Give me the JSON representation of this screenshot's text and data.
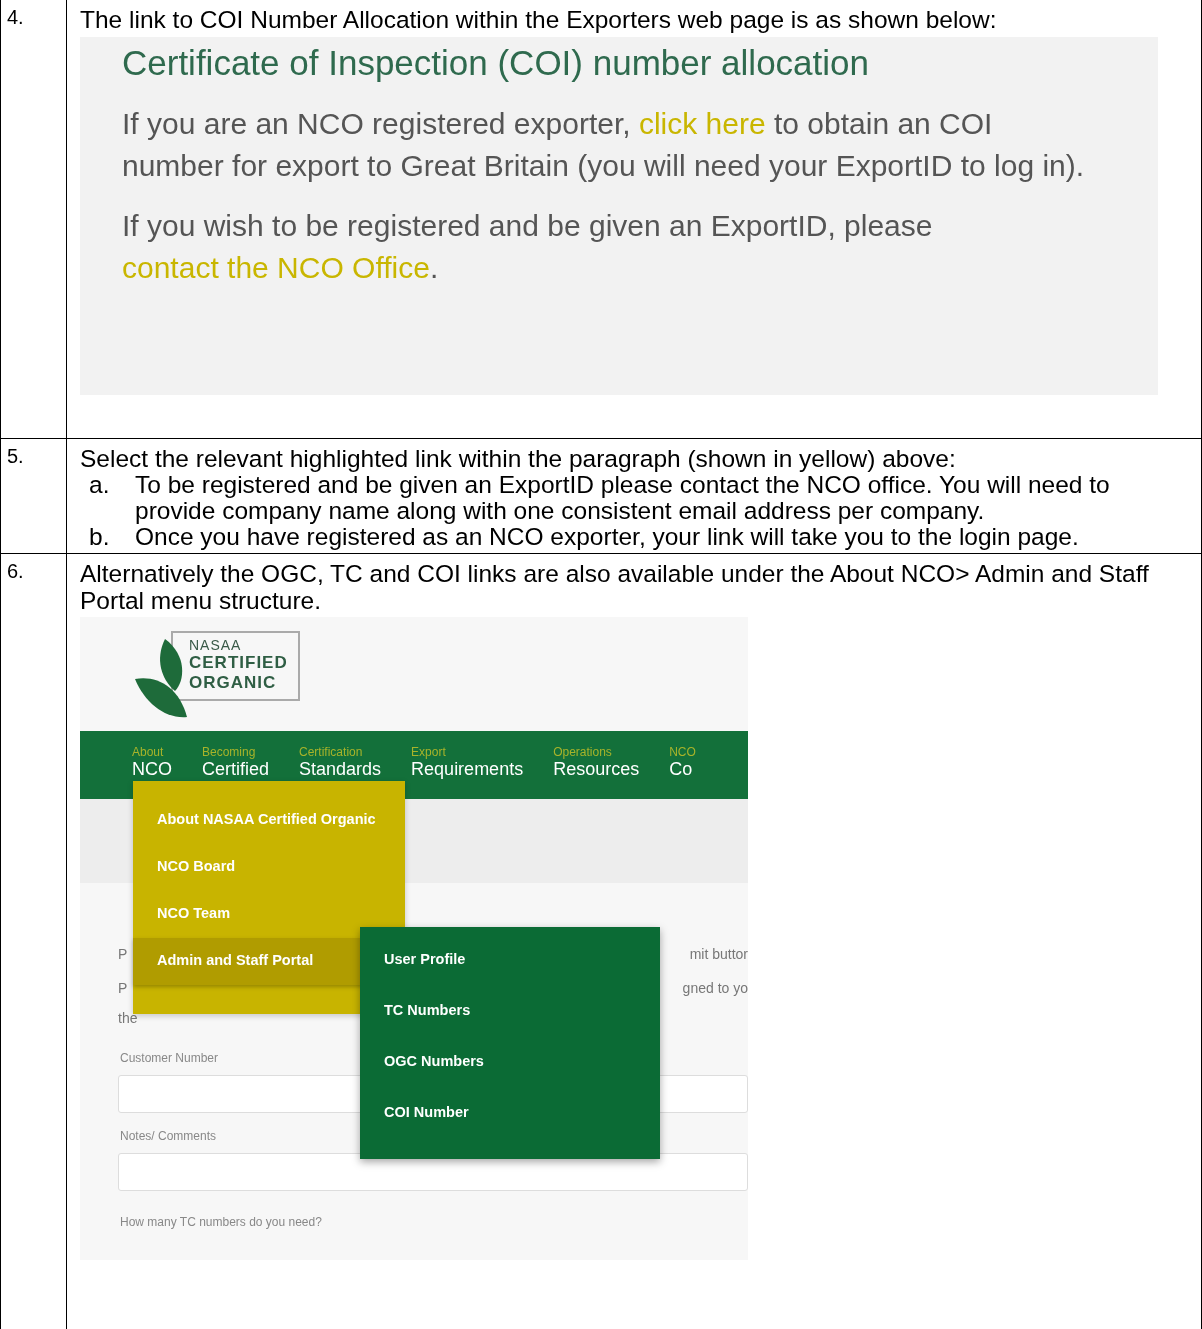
{
  "steps": [
    {
      "number": "4.",
      "kind": "panel",
      "text": "The link to COI Number Allocation within the Exporters web page is as shown below:",
      "panel": {
        "title": "Certificate of Inspection (COI) number allocation",
        "paragraphs": [
          [
            {
              "text": "If you are an NCO registered exporter, ",
              "kind": "text"
            },
            {
              "text": "click here",
              "kind": "link"
            },
            {
              "text": " to obtain an COI number for export to Great Britain (you will need your ExportID to log in).",
              "kind": "text"
            }
          ],
          [
            {
              "text": "If you wish to be registered and be given an ExportID, please ",
              "kind": "text"
            },
            {
              "text": "contact the NCO Office",
              "kind": "link"
            },
            {
              "text": ".",
              "kind": "text"
            }
          ]
        ]
      }
    },
    {
      "number": "5.",
      "kind": "list",
      "text": "Select the relevant highlighted link within the paragraph (shown in yellow) above:",
      "items": [
        {
          "marker": "a.",
          "text": "To be registered and be given an ExportID please contact the NCO office.  You will need to provide company name along with one consistent email address per company."
        },
        {
          "marker": "b.",
          "text": "Once you have registered as an NCO exporter, your link will take you to the login page."
        }
      ]
    },
    {
      "number": "6.",
      "kind": "site",
      "text": "Alternatively the OGC, TC and COI links are also available under the About NCO> Admin and Staff Portal menu structure.",
      "site": {
        "logo": {
          "small": "NASAA",
          "lines": [
            "CERTIFIED",
            "ORGANIC"
          ]
        },
        "nav": [
          {
            "top": "About",
            "bottom": "NCO"
          },
          {
            "top": "Becoming",
            "bottom": "Certified"
          },
          {
            "top": "Certification",
            "bottom": "Standards"
          },
          {
            "top": "Export",
            "bottom": "Requirements"
          },
          {
            "top": "Operations",
            "bottom": "Resources"
          },
          {
            "top": "NCO",
            "bottom": "Co"
          }
        ],
        "menu": [
          {
            "label": "About NASAA Certified Organic",
            "selected": false
          },
          {
            "label": "NCO Board",
            "selected": false
          },
          {
            "label": "NCO Team",
            "selected": false
          },
          {
            "label": "Admin and Staff Portal",
            "selected": true
          }
        ],
        "submenu": [
          "User Profile",
          "TC Numbers",
          "OGC Numbers",
          "COI Number"
        ],
        "text_fragments": [
          {
            "left": "P",
            "right": "mit buttor"
          },
          {
            "left": "P",
            "right": "gned to yo"
          },
          {
            "left": "the"
          }
        ],
        "fields": [
          {
            "label": "Customer Number"
          },
          {
            "label": "Notes/ Comments"
          }
        ],
        "question": "How many TC numbers do you need?"
      }
    }
  ]
}
